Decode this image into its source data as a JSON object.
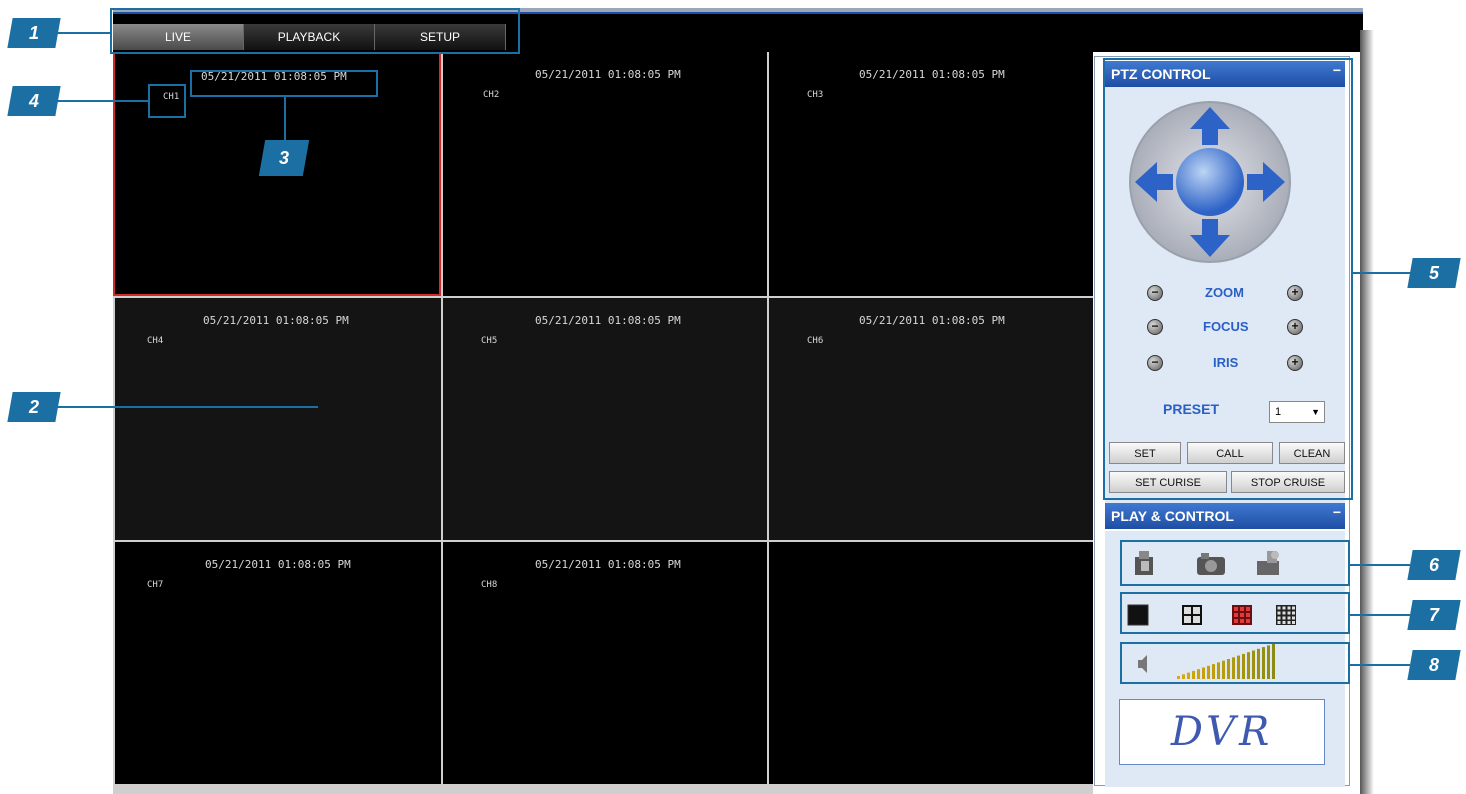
{
  "tabs": [
    {
      "label": "LIVE",
      "active": true
    },
    {
      "label": "PLAYBACK",
      "active": false
    },
    {
      "label": "SETUP",
      "active": false
    }
  ],
  "cameras": [
    {
      "timestamp": "05/21/2011 01:08:05 PM",
      "channel": "CH1"
    },
    {
      "timestamp": "05/21/2011 01:08:05 PM",
      "channel": "CH2"
    },
    {
      "timestamp": "05/21/2011 01:08:05 PM",
      "channel": "CH3"
    },
    {
      "timestamp": "05/21/2011 01:08:05 PM",
      "channel": "CH4"
    },
    {
      "timestamp": "05/21/2011 01:08:05 PM",
      "channel": "CH5"
    },
    {
      "timestamp": "05/21/2011 01:08:05 PM",
      "channel": "CH6"
    },
    {
      "timestamp": "05/21/2011 01:08:05 PM",
      "channel": "CH7"
    },
    {
      "timestamp": "05/21/2011 01:08:05 PM",
      "channel": "CH8"
    }
  ],
  "ptz": {
    "title": "PTZ CONTROL",
    "minimize": "−",
    "zoom_label": "ZOOM",
    "focus_label": "FOCUS",
    "iris_label": "IRIS",
    "minus": "−",
    "plus": "+",
    "preset_label": "PRESET",
    "preset_value": "1",
    "set_label": "SET",
    "call_label": "CALL",
    "clean_label": "CLEAN",
    "set_cruise_label": "SET CURISE",
    "stop_cruise_label": "STOP CRUISE"
  },
  "play": {
    "title": "PLAY & CONTROL",
    "minimize": "−",
    "icons": [
      "record-icon",
      "snapshot-icon",
      "camera-settings-icon"
    ],
    "layout_icons": [
      "layout-1x1-icon",
      "layout-2x2-icon",
      "layout-3x3-icon",
      "layout-4x4-icon"
    ],
    "volume_level": 1.0,
    "logo_text": "DVR"
  },
  "callouts": [
    "1",
    "2",
    "3",
    "4",
    "5",
    "6",
    "7",
    "8"
  ],
  "colors": {
    "accent": "#1c6fa3",
    "panel_header": "#2a5fc4",
    "selected_border": "#d02a2a"
  }
}
